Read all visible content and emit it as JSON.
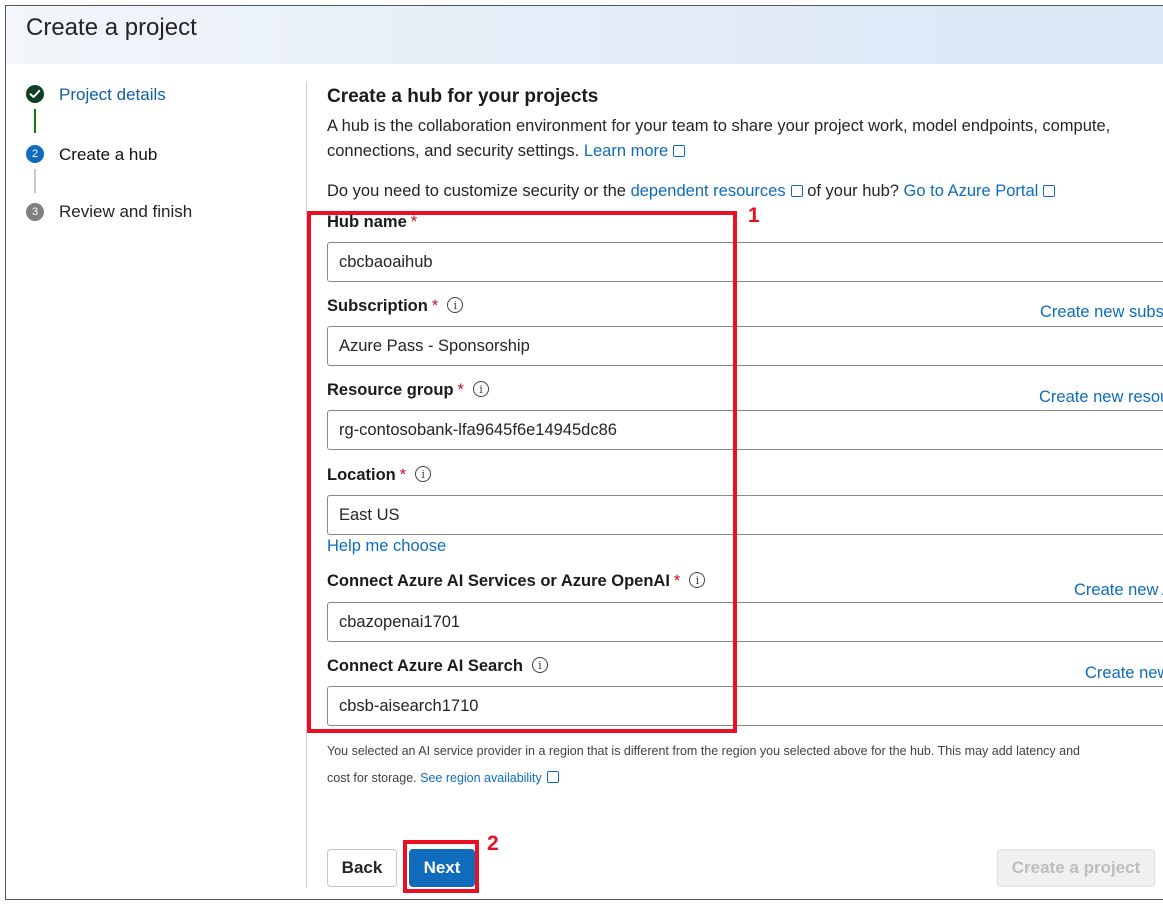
{
  "header": {
    "title": "Create a project"
  },
  "steps": [
    {
      "number": "",
      "label": "Project details",
      "state": "done"
    },
    {
      "number": "2",
      "label": "Create a hub",
      "state": "current"
    },
    {
      "number": "3",
      "label": "Review and finish",
      "state": "todo"
    }
  ],
  "main": {
    "title": "Create a hub for your projects",
    "desc_line1": "A hub is the collaboration environment for your team to share your project work, model endpoints, compute,",
    "desc_line2": "connections, and security settings.",
    "learn_more": "Learn more",
    "question_prefix": "Do you need to customize security or the",
    "dependent_resources": "dependent resources",
    "question_mid": "of your hub?",
    "azure_portal": "Go to Azure Portal"
  },
  "fields": {
    "hub_name": {
      "label": "Hub name",
      "value": "cbcbaoaihub"
    },
    "subscription": {
      "label": "Subscription",
      "value": "Azure Pass - Sponsorship",
      "create": "Create new subscription"
    },
    "resource_group": {
      "label": "Resource group",
      "value": "rg-contosobank-lfa9645f6e14945dc86",
      "create": "Create new resource group"
    },
    "location": {
      "label": "Location",
      "value": "East US",
      "help": "Help me choose"
    },
    "ai_services": {
      "label": "Connect Azure AI Services or Azure OpenAI",
      "value": "cbazopenai1701",
      "create": "Create new AI Services"
    },
    "ai_search": {
      "label": "Connect Azure AI Search",
      "value": "cbsb-aisearch1710",
      "create": "Create new AI Search"
    }
  },
  "note": {
    "line1": "You selected an AI service provider in a region that is different from the region you selected above for the hub. This may add latency and",
    "line2_prefix": "cost for storage.",
    "region_link": "See region availability"
  },
  "buttons": {
    "back": "Back",
    "next": "Next",
    "create": "Create a project"
  },
  "annotations": {
    "box1": "1",
    "box2": "2"
  },
  "colors": {
    "accent": "#0f6cbd",
    "annotation": "#e81123",
    "done": "#0e3f24",
    "required": "#c50f1f"
  },
  "icons": {
    "done_step": "checkmark-icon",
    "info": "info-icon",
    "external": "open-external-icon"
  }
}
